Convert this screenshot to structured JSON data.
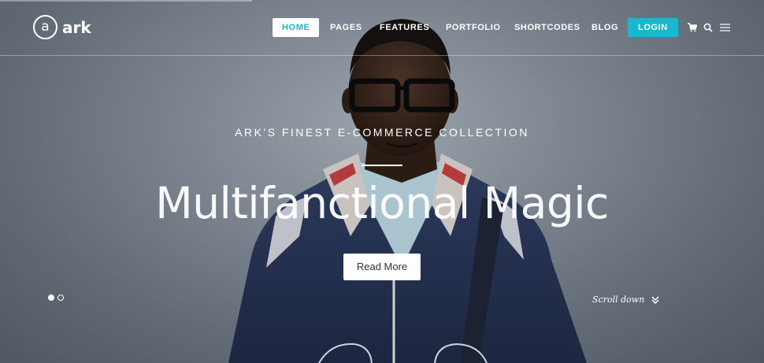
{
  "brand": {
    "logo_mark": "a",
    "logo_text": "ark"
  },
  "nav": {
    "items": [
      {
        "label": "HOME",
        "active": true
      },
      {
        "label": "PAGES",
        "active": false
      },
      {
        "label": "FEATURES",
        "active": false
      },
      {
        "label": "PORTFOLIO",
        "active": false
      },
      {
        "label": "SHORTCODES",
        "active": false
      },
      {
        "label": "BLOG",
        "active": false
      }
    ],
    "login_label": "LOGIN",
    "icons": [
      "cart-icon",
      "search-icon",
      "menu-icon"
    ],
    "accent_color": "#18b8d1"
  },
  "hero": {
    "subtitle": "ARK'S FINEST E-COMMERCE COLLECTION",
    "headline": "Multifanctional Magic",
    "cta_label": "Read More",
    "slides": {
      "count": 2,
      "active_index": 0
    },
    "scroll_label": "Scroll down"
  }
}
